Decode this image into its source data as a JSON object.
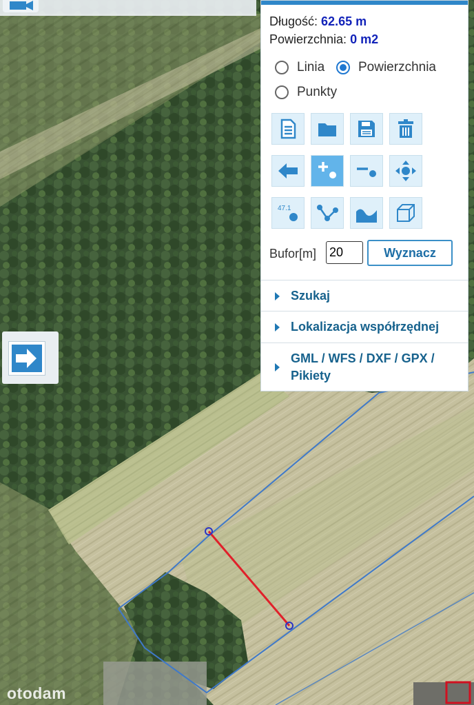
{
  "measurement": {
    "length_label": "Długość:",
    "length_value": "62.65 m",
    "area_label": "Powierzchnia:",
    "area_value": "0 m2"
  },
  "mode": {
    "options": [
      "Linia",
      "Powierzchnia",
      "Punkty"
    ],
    "selected": "Powierzchnia"
  },
  "toolbar": {
    "rows": [
      [
        "new-document-icon",
        "open-folder-icon",
        "save-icon",
        "trash-icon"
      ],
      [
        "back-arrow-icon",
        "add-point-icon",
        "line-point-icon",
        "move-icon"
      ],
      [
        "elevation-point-icon",
        "polyline-icon",
        "profile-icon",
        "3d-box-icon"
      ]
    ],
    "active": "add-point-icon"
  },
  "buffer": {
    "label": "Bufor[m]",
    "value": "20",
    "button_label": "Wyznacz"
  },
  "sections": [
    {
      "label": "Szukaj"
    },
    {
      "label": "Lokalizacja współrzędnej"
    },
    {
      "label": "GML / WFS / DXF / GPX / Pikiety"
    }
  ],
  "colors": {
    "accent": "#2f87c9",
    "measure_value": "#1223b9",
    "measure_line": "#e0202a",
    "parcel_border": "#3f79c9"
  },
  "watermark": "otodam"
}
